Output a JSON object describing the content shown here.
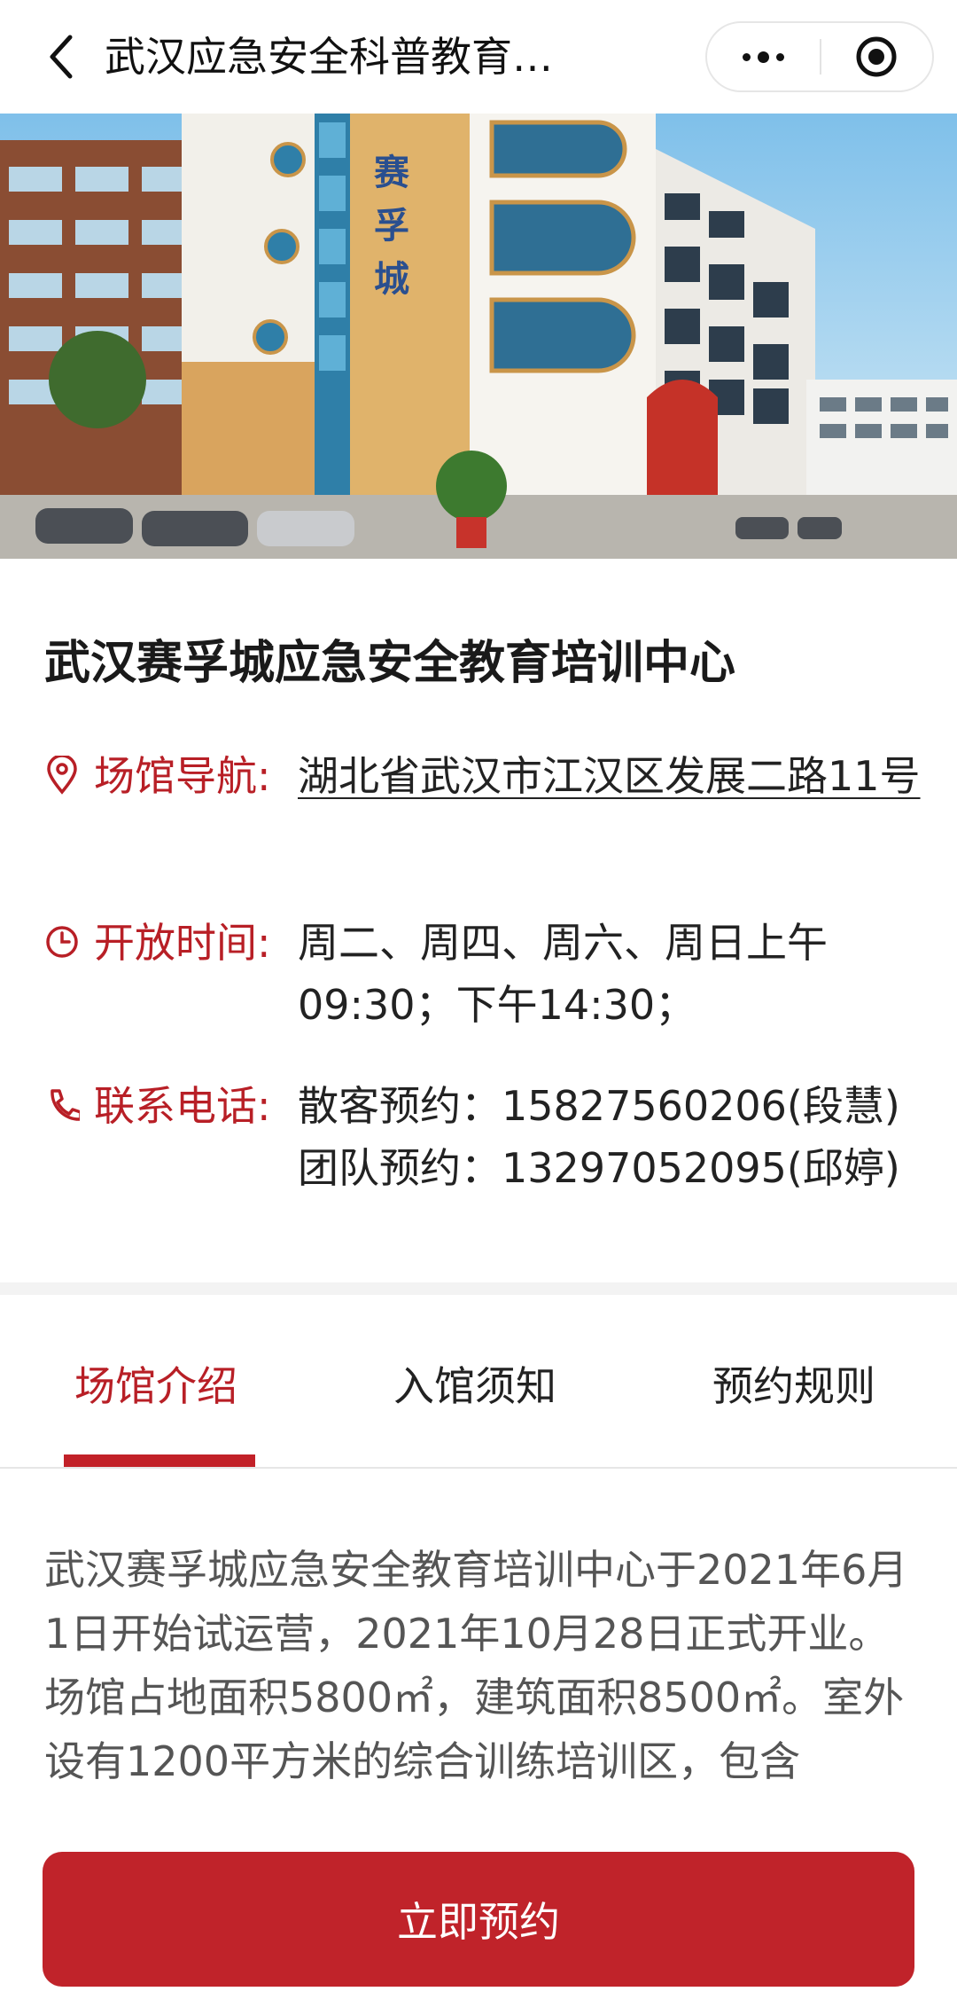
{
  "navbar": {
    "title": "武汉应急安全科普教育…"
  },
  "hero": {
    "building_sign": "赛孚城"
  },
  "venue": {
    "name": "武汉赛孚城应急安全教育培训中心",
    "address_label": "场馆导航:",
    "address_value": "湖北省武汉市江汉区发展二路11号",
    "hours_label": "开放时间:",
    "hours_value": "周二、周四、周六、周日上午09:30；下午14:30；",
    "phone_label": "联系电话:",
    "phone_line1": "散客预约：15827560206(段慧)",
    "phone_line2": "团队预约：13297052095(邱婷)"
  },
  "tabs": [
    {
      "label": "场馆介绍",
      "active": true
    },
    {
      "label": "入馆须知",
      "active": false
    },
    {
      "label": "预约规则",
      "active": false
    }
  ],
  "intro_text": "武汉赛孚城应急安全教育培训中心于2021年6月1日开始试运营，2021年10月28日正式开业。场馆占地面积5800㎡，建筑面积8500㎡。室外设有1200平方米的综合训练培训区，包含",
  "book_button": "立即预约",
  "colors": {
    "accent": "#b81f26",
    "button": "#c0232a",
    "divider": "#f3f3f3"
  },
  "icons": [
    "back-arrow-icon",
    "more-dots-icon",
    "close-target-icon",
    "location-pin-icon",
    "clock-icon",
    "phone-icon"
  ]
}
